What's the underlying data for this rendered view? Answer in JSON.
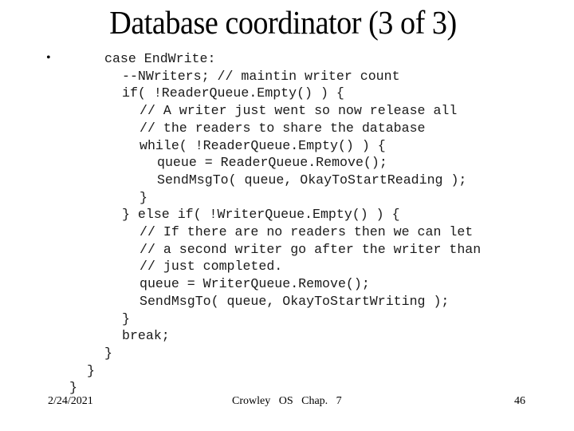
{
  "slide": {
    "title": "Database coordinator (3 of 3)",
    "bullet": "•",
    "code_lines": [
      {
        "indent": 0,
        "text": "case EndWrite:"
      },
      {
        "indent": 1,
        "text": "--NWriters; // maintin writer count"
      },
      {
        "indent": 1,
        "text": "if( !ReaderQueue.Empty() ) {"
      },
      {
        "indent": 2,
        "text": "// A writer just went so now release all"
      },
      {
        "indent": 2,
        "text": "// the readers to share the database"
      },
      {
        "indent": 2,
        "text": "while( !ReaderQueue.Empty() ) {"
      },
      {
        "indent": 3,
        "text": "queue = ReaderQueue.Remove();"
      },
      {
        "indent": 3,
        "text": "SendMsgTo( queue, OkayToStartReading );"
      },
      {
        "indent": 2,
        "text": "}"
      },
      {
        "indent": 1,
        "text": "} else if( !WriterQueue.Empty() ) {"
      },
      {
        "indent": 2,
        "text": "// If there are no readers then we can let"
      },
      {
        "indent": 2,
        "text": "// a second writer go after the writer than"
      },
      {
        "indent": 2,
        "text": "// just completed."
      },
      {
        "indent": 2,
        "text": "queue = WriterQueue.Remove();"
      },
      {
        "indent": 2,
        "text": "SendMsgTo( queue, OkayToStartWriting );"
      },
      {
        "indent": 1,
        "text": "}"
      },
      {
        "indent": 1,
        "text": "break;"
      },
      {
        "indent": 0,
        "text": "}"
      },
      {
        "indent": -1,
        "text": "}"
      },
      {
        "indent": -2,
        "text": "}"
      }
    ]
  },
  "footer": {
    "date": "2/24/2021",
    "center": "Crowley OS Chap. 7",
    "page_number": "46"
  }
}
